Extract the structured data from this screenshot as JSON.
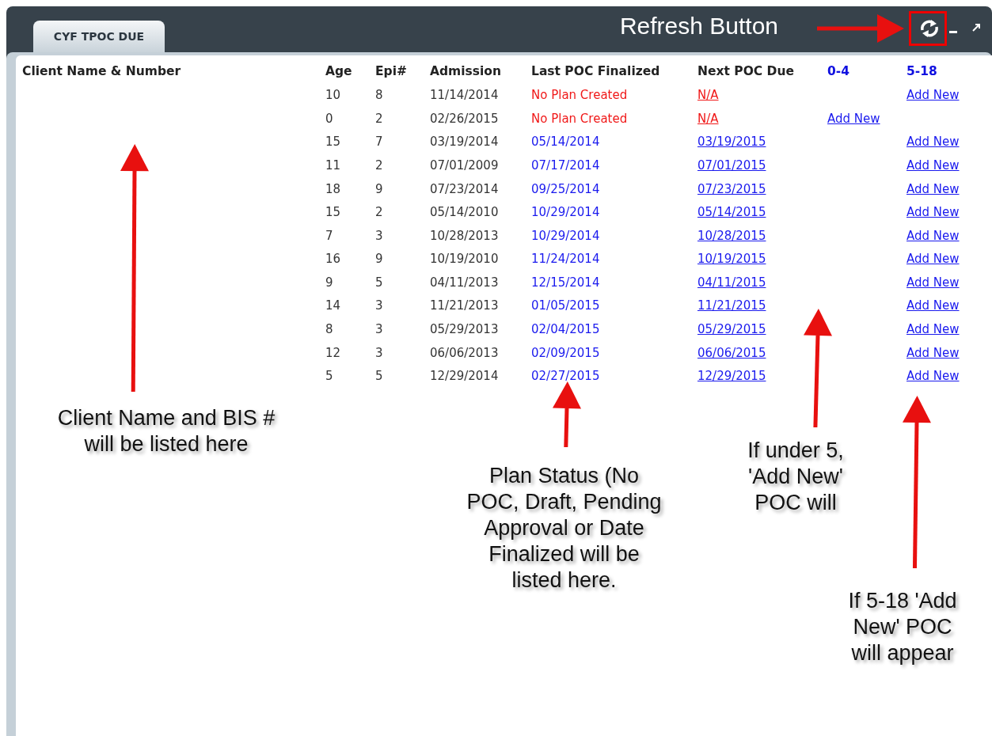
{
  "tab": {
    "label": "CYF TPOC DUE",
    "selected": true
  },
  "table": {
    "columns": [
      {
        "label": "Client Name & Number",
        "kind": "plain"
      },
      {
        "label": "Age",
        "kind": "plain"
      },
      {
        "label": "Epi#",
        "kind": "plain"
      },
      {
        "label": "Admission",
        "kind": "plain"
      },
      {
        "label": "Last POC Finalized",
        "kind": "plain"
      },
      {
        "label": "Next POC Due",
        "kind": "plain"
      },
      {
        "label": "0-4",
        "kind": "range"
      },
      {
        "label": "5-18",
        "kind": "range"
      }
    ],
    "rows": [
      {
        "age": "10",
        "epi": "8",
        "admission": "11/14/2014",
        "last_poc": "No Plan Created",
        "plan_created": false,
        "next_due": "N/A",
        "add_new_5_18": "Add New"
      },
      {
        "age": "0",
        "epi": "2",
        "admission": "02/26/2015",
        "last_poc": "No Plan Created",
        "plan_created": false,
        "next_due": "N/A",
        "add_new_0_4": "Add New"
      },
      {
        "age": "15",
        "epi": "7",
        "admission": "03/19/2014",
        "last_poc": "05/14/2014",
        "plan_created": true,
        "next_due": "03/19/2015",
        "add_new_5_18": "Add New"
      },
      {
        "age": "11",
        "epi": "2",
        "admission": "07/01/2009",
        "last_poc": "07/17/2014",
        "plan_created": true,
        "next_due": "07/01/2015",
        "add_new_5_18": "Add New"
      },
      {
        "age": "18",
        "epi": "9",
        "admission": "07/23/2014",
        "last_poc": "09/25/2014",
        "plan_created": true,
        "next_due": "07/23/2015",
        "add_new_5_18": "Add New"
      },
      {
        "age": "15",
        "epi": "2",
        "admission": "05/14/2010",
        "last_poc": "10/29/2014",
        "plan_created": true,
        "next_due": "05/14/2015",
        "add_new_5_18": "Add New"
      },
      {
        "age": "7",
        "epi": "3",
        "admission": "10/28/2013",
        "last_poc": "10/29/2014",
        "plan_created": true,
        "next_due": "10/28/2015",
        "add_new_5_18": "Add New"
      },
      {
        "age": "16",
        "epi": "9",
        "admission": "10/19/2010",
        "last_poc": "11/24/2014",
        "plan_created": true,
        "next_due": "10/19/2015",
        "add_new_5_18": "Add New"
      },
      {
        "age": "9",
        "epi": "5",
        "admission": "04/11/2013",
        "last_poc": "12/15/2014",
        "plan_created": true,
        "next_due": "04/11/2015",
        "add_new_5_18": "Add New"
      },
      {
        "age": "14",
        "epi": "3",
        "admission": "11/21/2013",
        "last_poc": "01/05/2015",
        "plan_created": true,
        "next_due": "11/21/2015",
        "add_new_5_18": "Add New"
      },
      {
        "age": "8",
        "epi": "3",
        "admission": "05/29/2013",
        "last_poc": "02/04/2015",
        "plan_created": true,
        "next_due": "05/29/2015",
        "add_new_5_18": "Add New"
      },
      {
        "age": "12",
        "epi": "3",
        "admission": "06/06/2013",
        "last_poc": "02/09/2015",
        "plan_created": true,
        "next_due": "06/06/2015",
        "add_new_5_18": "Add New"
      },
      {
        "age": "5",
        "epi": "5",
        "admission": "12/29/2014",
        "last_poc": "02/27/2015",
        "plan_created": true,
        "next_due": "12/29/2015",
        "add_new_5_18": "Add New"
      }
    ]
  },
  "annotations": [
    {
      "kind": "header_label",
      "text": "Refresh Button"
    },
    {
      "kind": "callout",
      "text": "Client Name and BIS #\nwill be listed here"
    },
    {
      "kind": "callout",
      "text": "Plan Status (No\nPOC, Draft, Pending\nApproval or Date\nFinalized will be\nlisted here."
    },
    {
      "kind": "callout",
      "text": "If under 5,\n'Add New'\nPOC will"
    },
    {
      "kind": "callout",
      "text": "If 5-18 'Add\nNew' POC\nwill appear"
    }
  ]
}
